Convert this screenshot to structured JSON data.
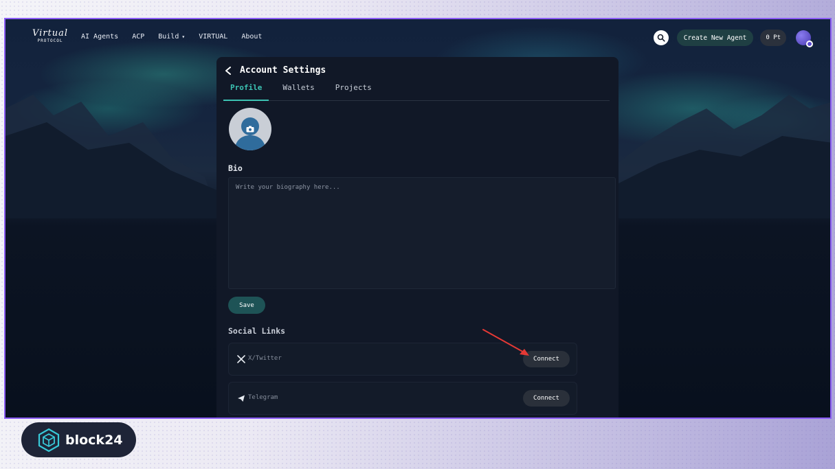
{
  "nav": {
    "logo_script": "Virtual",
    "logo_sub": "PROTOCOL",
    "links": [
      "AI Agents",
      "ACP",
      "Build",
      "VIRTUAL",
      "About"
    ],
    "build_caret": "▾",
    "create_button": "Create New Agent",
    "points": "0 Pt"
  },
  "panel": {
    "back_icon": "chevron-left-icon",
    "title": "Account Settings",
    "tabs": [
      {
        "label": "Profile",
        "active": true
      },
      {
        "label": "Wallets",
        "active": false
      },
      {
        "label": "Projects",
        "active": false
      }
    ],
    "bio_label": "Bio",
    "bio_placeholder": "Write your biography here...",
    "save_label": "Save",
    "social_title": "Social Links",
    "social_links": [
      {
        "icon": "x-twitter-icon",
        "label": "X/Twitter",
        "button": "Connect"
      },
      {
        "icon": "telegram-icon",
        "label": "Telegram",
        "button": "Connect"
      }
    ]
  },
  "badge": {
    "text": "block24"
  },
  "colors": {
    "accent": "#3cc3b3",
    "frame_border": "#8b5cf6",
    "annotation_arrow": "#e53935",
    "panel_bg": "#111827"
  }
}
